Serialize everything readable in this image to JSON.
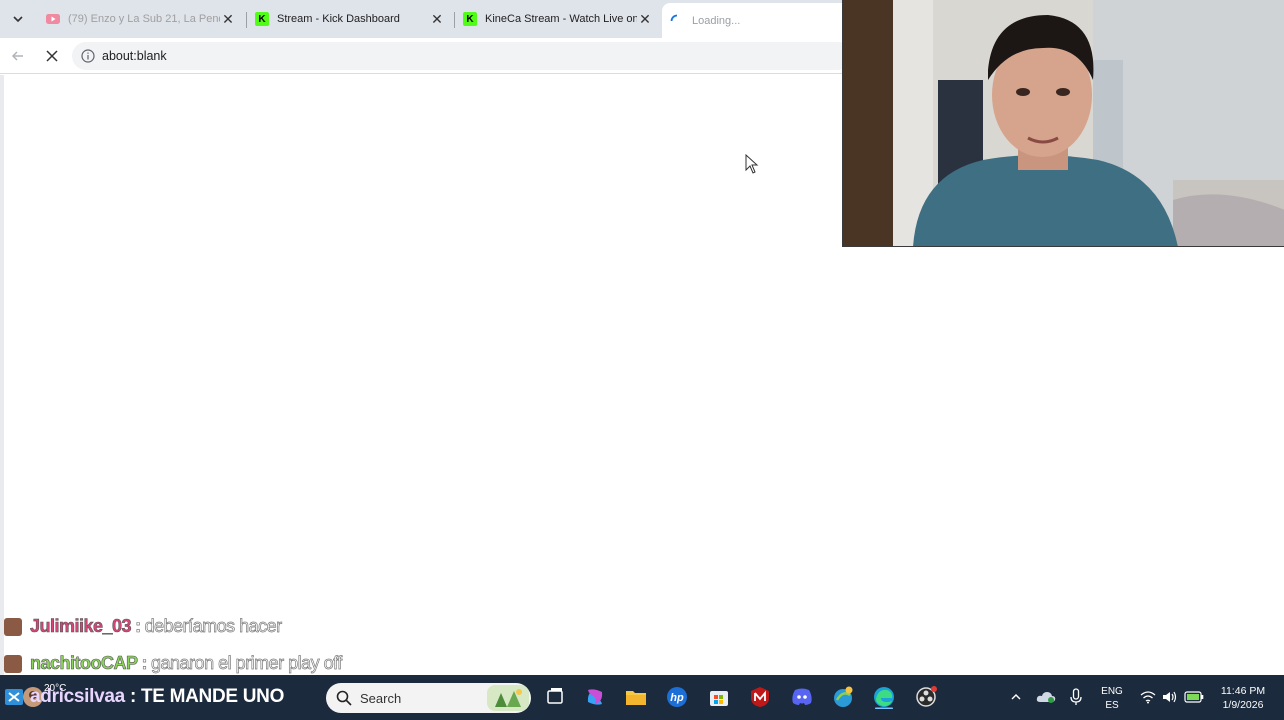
{
  "browser": {
    "tabs": [
      {
        "title": "(79) Enzo y La Sub 21, La Pend",
        "favicon": "youtube-icon",
        "state": "muted"
      },
      {
        "title": "Stream - Kick Dashboard",
        "favicon": "kick-icon",
        "state": "normal"
      },
      {
        "title": "KineCa Stream - Watch Live on",
        "favicon": "kick-icon",
        "state": "normal"
      },
      {
        "title": "Loading...",
        "favicon": "loading-spinner-icon",
        "state": "active"
      }
    ],
    "kick_favicon_letter": "K",
    "address_bar": {
      "url": "about:blank"
    }
  },
  "chat": [
    {
      "user": "Julimiike_03",
      "user_color": "#d9457a",
      "separator": ":",
      "message": "deberíamos hacer"
    },
    {
      "user": "nachitooCAP",
      "user_color": "#8ad45a",
      "separator": ":",
      "message": "ganaron el primer play off"
    }
  ],
  "overlay_banner": {
    "user": "adricsilvaa",
    "separator": ":",
    "text": "TE MANDE UNO"
  },
  "taskbar": {
    "weather_temp": "20°C",
    "search_label": "Search",
    "language_primary": "ENG",
    "language_secondary": "ES",
    "time": "11:46 PM",
    "date": "1/9/2026"
  },
  "colors": {
    "tabbar_bg": "#dfe3ea",
    "taskbar_bg": "#1b2a3d",
    "kick_green": "#53fc18"
  }
}
